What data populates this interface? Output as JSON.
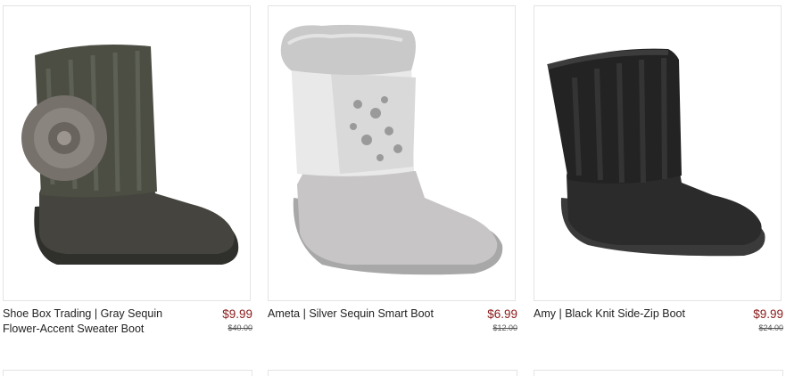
{
  "products": [
    {
      "title": "Shoe Box Trading | Gray Sequin Flower-Accent Sweater Boot",
      "price": "$9.99",
      "was_price": "$40.00",
      "image": "gray-sweater-boot-with-flower"
    },
    {
      "title": "Ameta | Silver Sequin Smart Boot",
      "price": "$6.99",
      "was_price": "$12.00",
      "image": "silver-sequin-fur-boot"
    },
    {
      "title": "Amy | Black Knit Side-Zip Boot",
      "price": "$9.99",
      "was_price": "$24.00",
      "image": "black-knit-boot"
    }
  ],
  "colors": {
    "price": "#8b1a1a",
    "border": "#e3e3e3"
  }
}
